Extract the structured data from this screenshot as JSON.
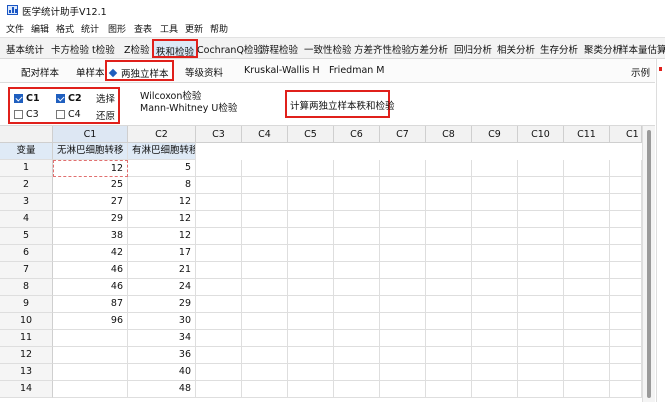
{
  "window": {
    "title": "医学统计助手V12.1"
  },
  "menu": [
    "文件",
    "编辑",
    "格式",
    "统计",
    "图形",
    "查表",
    "工具",
    "更新",
    "帮助"
  ],
  "tabs": [
    "基本统计",
    "卡方检验",
    "t检验",
    "Z检验",
    "秩和检验",
    "CochranQ检验",
    "游程检验",
    "一致性检验",
    "方差齐性检验",
    "方差分析",
    "回归分析",
    "相关分析",
    "生存分析",
    "聚类分析",
    "样本量估算"
  ],
  "subtabs": [
    "配对样本",
    "单样本",
    "两独立样本",
    "等级资料",
    "Kruskal-Wallis H",
    "Friedman M"
  ],
  "example_label": "示例",
  "options": {
    "c1": "C1",
    "c2": "C2",
    "c3": "C3",
    "c4": "C4",
    "select": "选择",
    "restore": "还原",
    "method1": "Wilcoxon检验",
    "method2": "Mann-Whitney U检验",
    "calc_button": "计算两独立样本秩和检验"
  },
  "grid": {
    "columns": [
      "",
      "C1",
      "C2",
      "C3",
      "C4",
      "C5",
      "C6",
      "C7",
      "C8",
      "C9",
      "C10",
      "C11",
      "C1"
    ],
    "var_label": "变量",
    "var_names": [
      "无淋巴细胞转移",
      "有淋巴细胞转移"
    ],
    "rows": [
      {
        "n": "1",
        "c1": "12",
        "c2": "5"
      },
      {
        "n": "2",
        "c1": "25",
        "c2": "8"
      },
      {
        "n": "3",
        "c1": "27",
        "c2": "12"
      },
      {
        "n": "4",
        "c1": "29",
        "c2": "12"
      },
      {
        "n": "5",
        "c1": "38",
        "c2": "12"
      },
      {
        "n": "6",
        "c1": "42",
        "c2": "17"
      },
      {
        "n": "7",
        "c1": "46",
        "c2": "21"
      },
      {
        "n": "8",
        "c1": "46",
        "c2": "24"
      },
      {
        "n": "9",
        "c1": "87",
        "c2": "29"
      },
      {
        "n": "10",
        "c1": "96",
        "c2": "30"
      },
      {
        "n": "11",
        "c1": "",
        "c2": "34"
      },
      {
        "n": "12",
        "c1": "",
        "c2": "36"
      },
      {
        "n": "13",
        "c1": "",
        "c2": "40"
      },
      {
        "n": "14",
        "c1": "",
        "c2": "48"
      }
    ]
  }
}
